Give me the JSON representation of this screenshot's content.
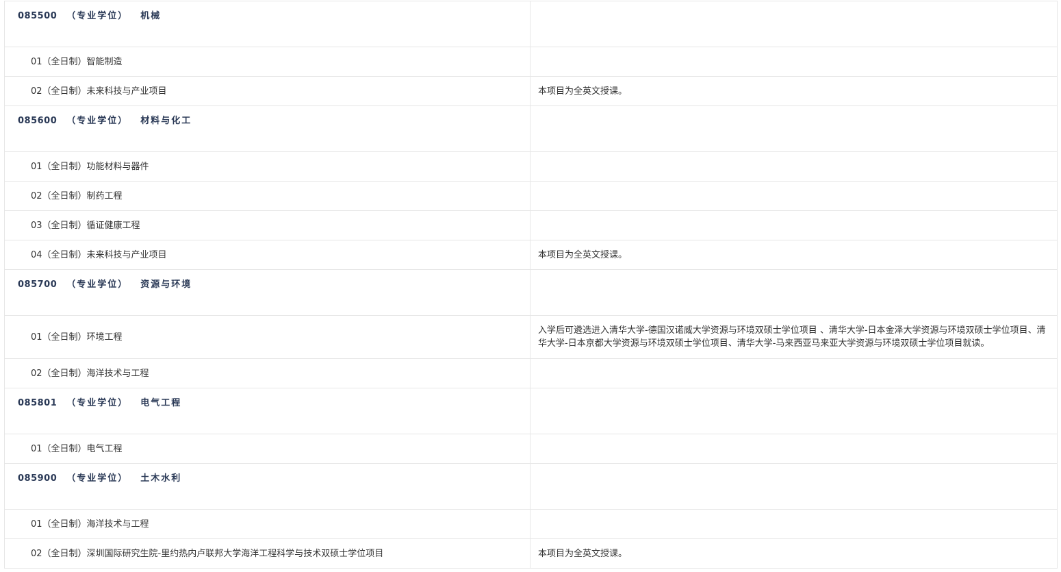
{
  "rows": [
    {
      "kind": "major",
      "code": "085500",
      "degree": "（专业学位）",
      "name": "机械",
      "note": ""
    },
    {
      "kind": "dir",
      "label": "01（全日制）智能制造",
      "note": ""
    },
    {
      "kind": "dir",
      "label": "02（全日制）未来科技与产业项目",
      "note": "本项目为全英文授课。"
    },
    {
      "kind": "major",
      "code": "085600",
      "degree": "（专业学位）",
      "name": "材料与化工",
      "note": ""
    },
    {
      "kind": "dir",
      "label": "01（全日制）功能材料与器件",
      "note": ""
    },
    {
      "kind": "dir",
      "label": "02（全日制）制药工程",
      "note": ""
    },
    {
      "kind": "dir",
      "label": "03（全日制）循证健康工程",
      "note": ""
    },
    {
      "kind": "dir",
      "label": "04（全日制）未来科技与产业项目",
      "note": "本项目为全英文授课。"
    },
    {
      "kind": "major",
      "code": "085700",
      "degree": "（专业学位）",
      "name": "资源与环境",
      "note": ""
    },
    {
      "kind": "dir",
      "label": "01（全日制）环境工程",
      "note": "入学后可遴选进入清华大学-德国汉诺威大学资源与环境双硕士学位项目 、清华大学-日本金泽大学资源与环境双硕士学位项目、清华大学-日本京都大学资源与环境双硕士学位项目、清华大学-马来西亚马来亚大学资源与环境双硕士学位项目就读。",
      "tall": true
    },
    {
      "kind": "dir",
      "label": "02（全日制）海洋技术与工程",
      "note": ""
    },
    {
      "kind": "major",
      "code": "085801",
      "degree": "（专业学位）",
      "name": "电气工程",
      "note": ""
    },
    {
      "kind": "dir",
      "label": "01（全日制）电气工程",
      "note": ""
    },
    {
      "kind": "major",
      "code": "085900",
      "degree": "（专业学位）",
      "name": "土木水利",
      "note": ""
    },
    {
      "kind": "dir",
      "label": "01（全日制）海洋技术与工程",
      "note": ""
    },
    {
      "kind": "dir",
      "label": "02（全日制）深圳国际研究生院-里约热内卢联邦大学海洋工程科学与技术双硕士学位项目",
      "note": "本项目为全英文授课。"
    }
  ]
}
